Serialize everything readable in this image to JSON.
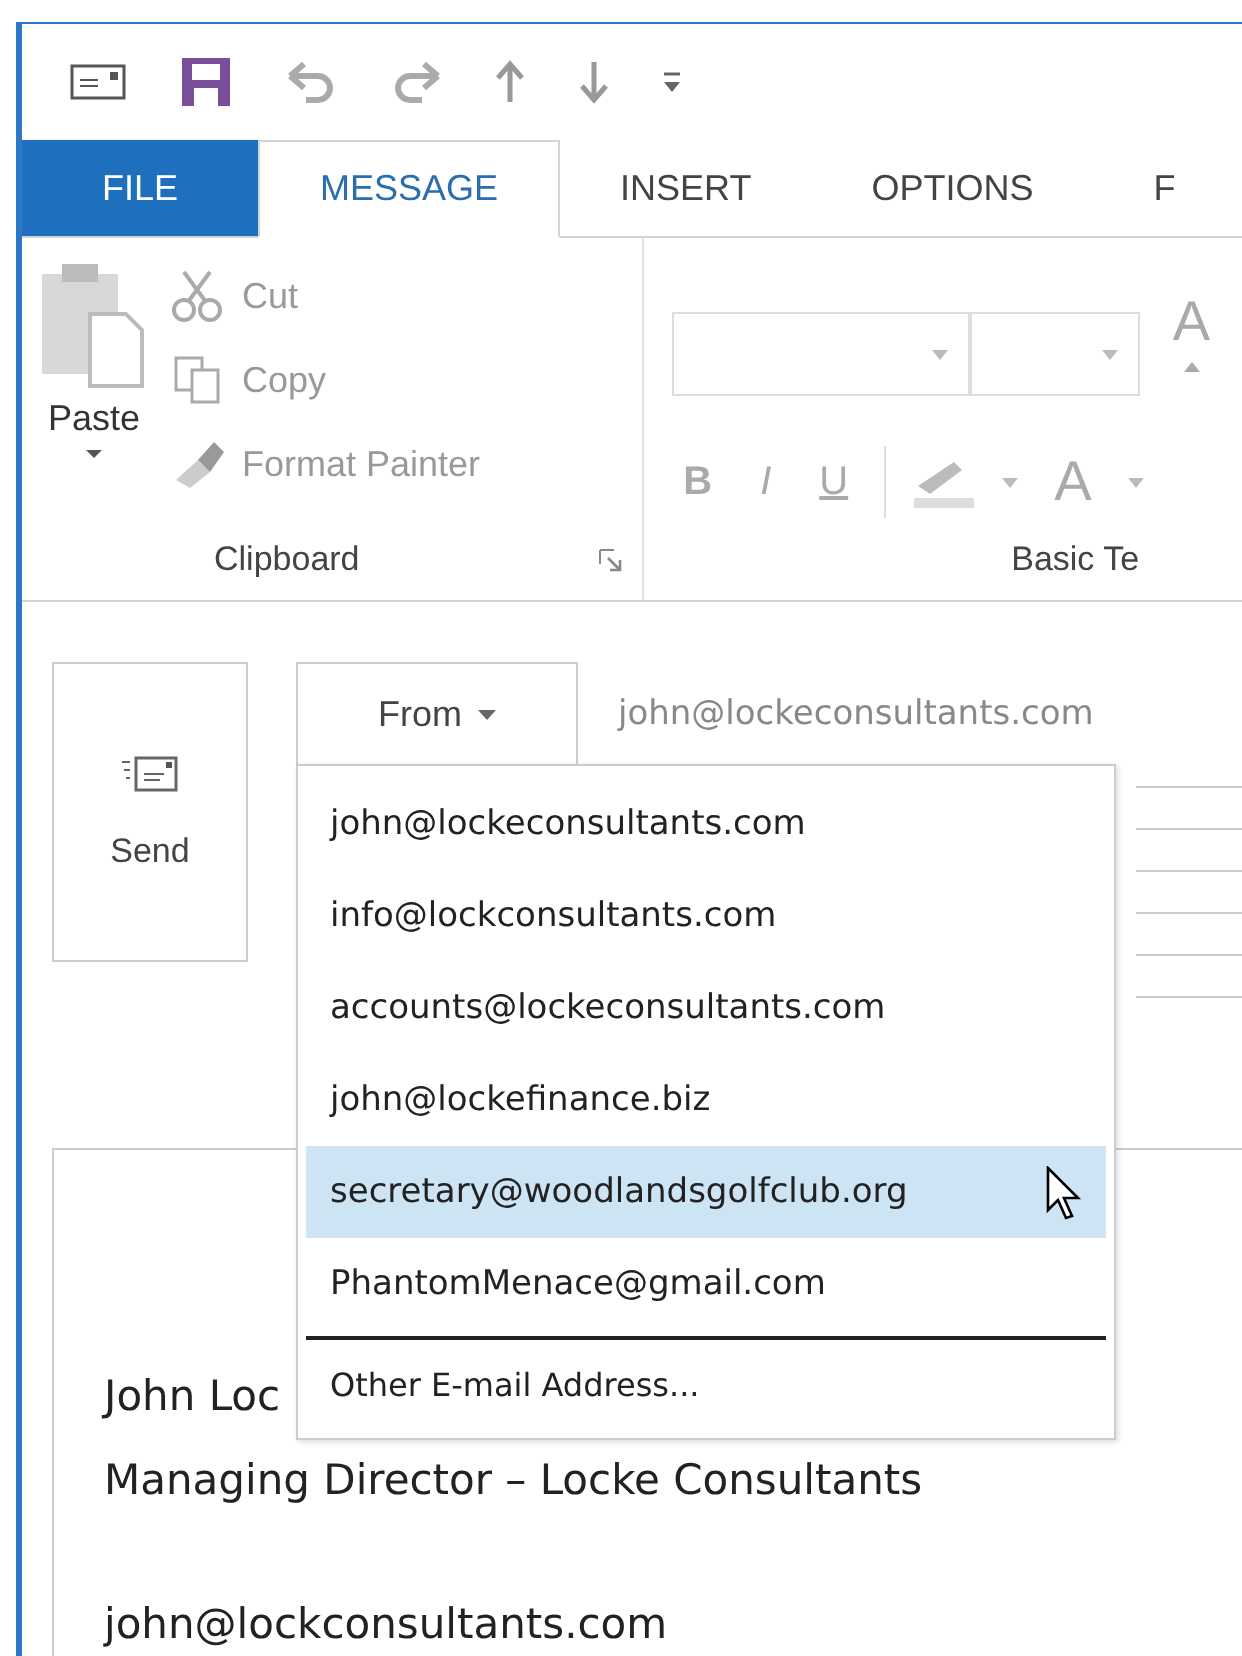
{
  "tabs": [
    {
      "label": "FILE",
      "kind": "backstage",
      "selected": false
    },
    {
      "label": "MESSAGE",
      "kind": "tab",
      "selected": true
    },
    {
      "label": "INSERT",
      "kind": "tab",
      "selected": false
    },
    {
      "label": "OPTIONS",
      "kind": "tab",
      "selected": false
    },
    {
      "label": "F",
      "kind": "tab",
      "selected": false
    }
  ],
  "clipboard": {
    "paste": "Paste",
    "cut": "Cut",
    "copy": "Copy",
    "format_painter": "Format Painter",
    "label": "Clipboard"
  },
  "basic_text": {
    "bold": "B",
    "italic": "I",
    "underline": "U",
    "font_color": "A",
    "grow_font": "A",
    "label": "Basic Te"
  },
  "send": {
    "label": "Send"
  },
  "from": {
    "label": "From",
    "value": "john@lockeconsultants.com"
  },
  "from_menu": [
    {
      "label": "john@lockeconsultants.com",
      "kind": "account",
      "selected": false
    },
    {
      "label": "info@lockconsultants.com",
      "kind": "account",
      "selected": false
    },
    {
      "label": "accounts@lockeconsultants.com",
      "kind": "account",
      "selected": false
    },
    {
      "label": "john@lockefinance.biz",
      "kind": "account",
      "selected": false
    },
    {
      "label": "secretary@woodlandsgolfclub.org",
      "kind": "account",
      "selected": true
    },
    {
      "label": "PhantomMenace@gmail.com",
      "kind": "account",
      "selected": false
    },
    {
      "label": "Other E-mail Address...",
      "kind": "other",
      "selected": false
    }
  ],
  "body": {
    "signature": [
      "John Loc",
      "Managing Director – Locke Consultants"
    ],
    "email": "john@lockconsultants.com"
  }
}
